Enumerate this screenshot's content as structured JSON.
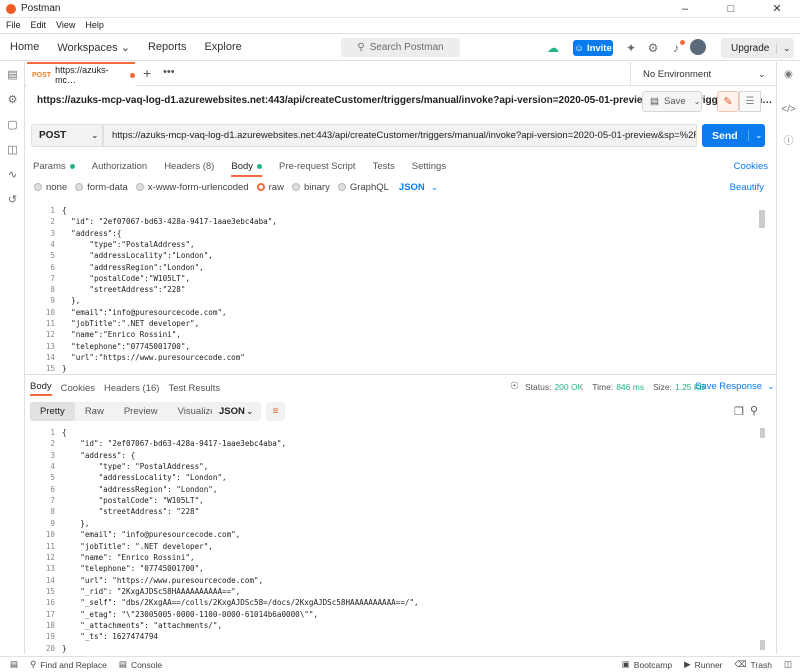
{
  "window": {
    "title": "Postman",
    "controls": [
      "–",
      "□",
      "✕"
    ]
  },
  "menu": [
    "File",
    "Edit",
    "View",
    "Help"
  ],
  "header": {
    "nav": [
      "Home",
      "Workspaces ⌄",
      "Reports",
      "Explore"
    ],
    "search_placeholder": "Search Postman",
    "invite_label": "Invite",
    "upgrade_label": "Upgrade"
  },
  "tab": {
    "method": "POST",
    "label": "https://azuks-mc…"
  },
  "environment": "No Environment",
  "request": {
    "title_url": "https://azuks-mcp-vaq-log-d1.azurewebsites.net:443/api/createCustomer/triggers/manual/invoke?api-version=2020-05-01-preview&sp=%2Ftriggers%2Fm…",
    "save_label": "Save",
    "method": "POST",
    "url": "https://azuks-mcp-vaq-log-d1.azurewebsites.net:443/api/createCustomer/triggers/manual/invoke?api-version=2020-05-01-preview&sp=%2Ftriggers%2Fmanu…",
    "send_label": "Send"
  },
  "request_tabs": {
    "params": "Params",
    "authorization": "Authorization",
    "headers": "Headers (8)",
    "body": "Body",
    "prerequest": "Pre-request Script",
    "tests": "Tests",
    "settings": "Settings",
    "cookies": "Cookies"
  },
  "body_options": {
    "none": "none",
    "form_data": "form-data",
    "urlencoded": "x-www-form-urlencoded",
    "raw": "raw",
    "binary": "binary",
    "graphql": "GraphQL",
    "format": "JSON",
    "beautify": "Beautify"
  },
  "request_body_lines": [
    "{",
    "  \"id\": \"2ef07067-bd63-428a-9417-1aae3ebc4aba\",",
    "  \"address\":{",
    "      \"type\":\"PostalAddress\",",
    "      \"addressLocality\":\"London\",",
    "      \"addressRegion\":\"London\",",
    "      \"postalCode\":\"W105LT\",",
    "      \"streetAddress\":\"228\"",
    "  },",
    "  \"email\":\"info@puresourcecode.com\",",
    "  \"jobTitle\":\".NET developer\",",
    "  \"name\":\"Enrico Rossini\",",
    "  \"telephone\":\"07745001700\",",
    "  \"url\":\"https://www.puresourcecode.com\"",
    "}"
  ],
  "response_tabs": {
    "body": "Body",
    "cookies": "Cookies",
    "headers": "Headers (16)",
    "test_results": "Test Results",
    "status_label": "Status:",
    "status": "200 OK",
    "time_label": "Time:",
    "time": "846 ms",
    "size_label": "Size:",
    "size": "1.25 KB",
    "save_response": "Save Response"
  },
  "view_tabs": {
    "pretty": "Pretty",
    "raw": "Raw",
    "preview": "Preview",
    "visualize": "Visualize",
    "format": "JSON"
  },
  "response_body_lines": [
    "{",
    "    \"id\": \"2ef07067-bd63-428a-9417-1aae3ebc4aba\",",
    "    \"address\": {",
    "        \"type\": \"PostalAddress\",",
    "        \"addressLocality\": \"London\",",
    "        \"addressRegion\": \"London\",",
    "        \"postalCode\": \"W105LT\",",
    "        \"streetAddress\": \"228\"",
    "    },",
    "    \"email\": \"info@puresourcecode.com\",",
    "    \"jobTitle\": \".NET developer\",",
    "    \"name\": \"Enrico Rossini\",",
    "    \"telephone\": \"07745001700\",",
    "    \"url\": \"https://www.puresourcecode.com\",",
    "    \"_rid\": \"2KxgAJDSc58HAAAAAAAAAA==\",",
    "    \"_self\": \"dbs/2KxgAA==/colls/2KxgAJDSc58=/docs/2KxgAJDSc58HAAAAAAAAAA==/\",",
    "    \"_etag\": \"\\\"23005005-0000-1100-0000-61014b6a0000\\\"\",",
    "    \"_attachments\": \"attachments/\",",
    "    \"_ts\": 1627474794",
    "}"
  ],
  "footer": {
    "find_replace": "Find and Replace",
    "console": "Console",
    "bootcamp": "Bootcamp",
    "runner": "Runner",
    "trash": "Trash"
  },
  "colors": {
    "accent": "#f26b3a",
    "primary": "#097bed",
    "success": "#26b47f"
  }
}
